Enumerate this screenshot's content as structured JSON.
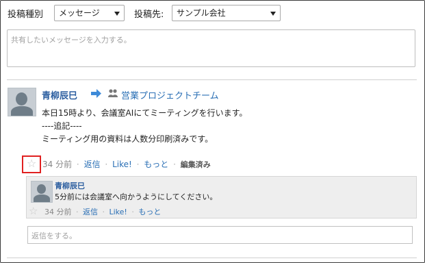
{
  "toolbar": {
    "category_label": "投稿種別",
    "category_value": "メッセージ",
    "destination_label": "投稿先:",
    "destination_value": "サンプル会社"
  },
  "compose": {
    "placeholder": "共有したいメッセージを入力する。"
  },
  "post": {
    "author": "青柳辰巳",
    "group": "営業プロジェクトチーム",
    "lines": [
      "本日15時より、会議室AIにてミーティングを行います。",
      "----追記----",
      "ミーティング用の資料は人数分印刷済みです。"
    ],
    "time": "34 分前",
    "reply_label": "返信",
    "like_label": "Like!",
    "more_label": "もっと",
    "edited_label": "編集済み"
  },
  "reply": {
    "author": "青柳辰巳",
    "text": "5分前には会議室へ向かうようにしてください。",
    "time": "34 分前",
    "reply_label": "返信",
    "like_label": "Like!",
    "more_label": "もっと"
  },
  "reply_input": {
    "placeholder": "返信をする。"
  },
  "icons": {
    "arrow": "arrow-right-icon",
    "group": "group-people-icon",
    "star": "star-icon"
  },
  "colors": {
    "link": "#2a6fb5",
    "author": "#2a5d9f",
    "highlight": "#e02020"
  }
}
